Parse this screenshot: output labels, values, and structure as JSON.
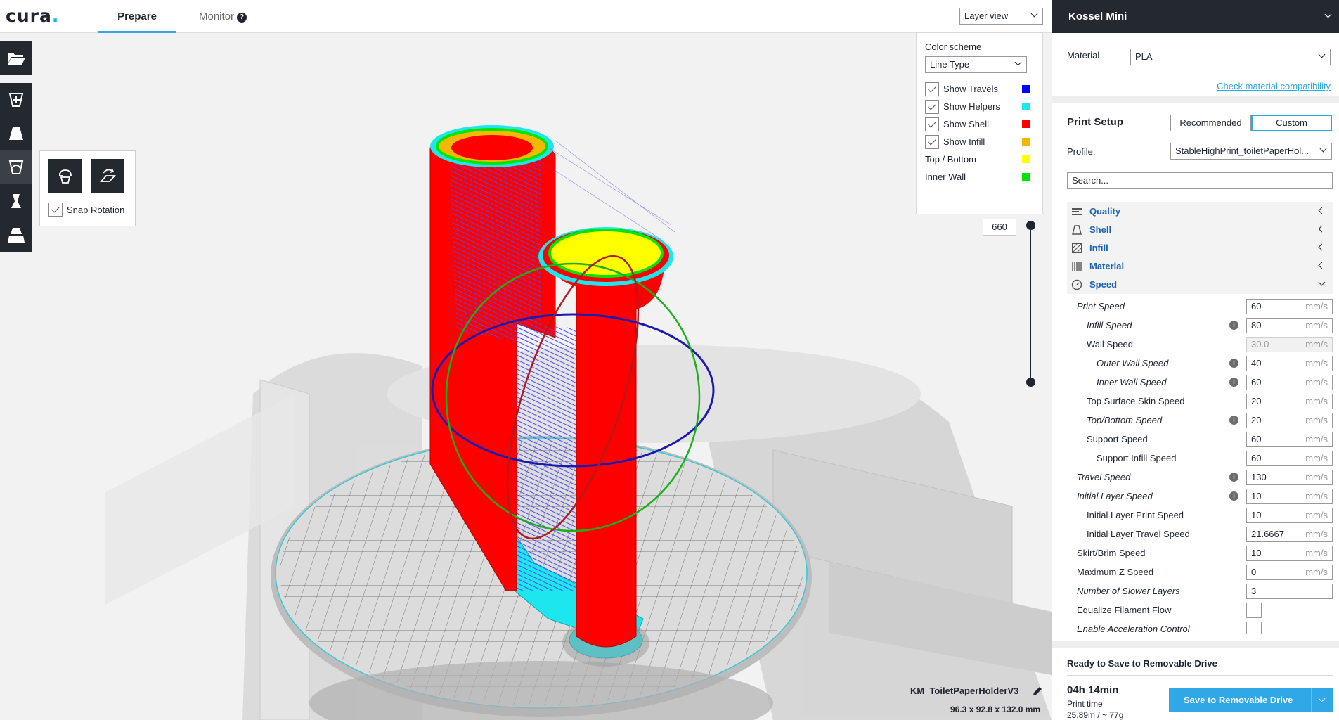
{
  "app": {
    "logo": "cura",
    "logo_dot": "."
  },
  "tabs": [
    {
      "label": "Prepare",
      "active": true
    },
    {
      "label": "Monitor",
      "active": false
    }
  ],
  "help_icon": "?",
  "view_select": {
    "value": "Layer view"
  },
  "left_tools": [
    "open-file-icon",
    "move-icon",
    "scale-icon",
    "rotate-icon",
    "mirror-icon",
    "per-model-settings-icon"
  ],
  "rotate_panel": {
    "snap_label": "Snap Rotation",
    "snap_checked": true
  },
  "legend": {
    "title": "Color scheme",
    "scheme": "Line Type",
    "rows": [
      {
        "label": "Show Travels",
        "checked": true,
        "color": "#0000ff"
      },
      {
        "label": "Show Helpers",
        "checked": true,
        "color": "#1ee6ee"
      },
      {
        "label": "Show Shell",
        "checked": true,
        "color": "#ff0000"
      },
      {
        "label": "Show Infill",
        "checked": true,
        "color": "#f5b800"
      },
      {
        "label": "Top / Bottom",
        "checked": null,
        "color": "#ffff00"
      },
      {
        "label": "Inner Wall",
        "checked": null,
        "color": "#00e600"
      }
    ]
  },
  "layer": {
    "number": "660"
  },
  "model": {
    "name": "KM_ToiletPaperHolderV3",
    "dimensions": "96.3 x 92.8 x 132.0 mm"
  },
  "printer": {
    "name": "Kossel Mini"
  },
  "material": {
    "label": "Material",
    "value": "PLA",
    "link": "Check material compatibility"
  },
  "print_setup": {
    "title": "Print Setup",
    "mode_recommended": "Recommended",
    "mode_custom": "Custom",
    "profile_label": "Profile:",
    "profile_value": "StableHighPrint_toiletPaperHol...",
    "search_placeholder": "Search..."
  },
  "sections": [
    {
      "label": "Quality",
      "icon": "quality-icon",
      "open": false
    },
    {
      "label": "Shell",
      "icon": "shell-icon",
      "open": false
    },
    {
      "label": "Infill",
      "icon": "infill-icon",
      "open": false
    },
    {
      "label": "Material",
      "icon": "material-icon",
      "open": false
    },
    {
      "label": "Speed",
      "icon": "speed-icon",
      "open": true
    }
  ],
  "speed_settings": [
    {
      "label": "Print Speed",
      "value": "60",
      "unit": "mm/s",
      "indent": 0,
      "italic": true,
      "info": false,
      "disabled": false
    },
    {
      "label": "Infill Speed",
      "value": "80",
      "unit": "mm/s",
      "indent": 1,
      "italic": true,
      "info": true,
      "disabled": false
    },
    {
      "label": "Wall Speed",
      "value": "30.0",
      "unit": "mm/s",
      "indent": 1,
      "italic": false,
      "info": false,
      "disabled": true
    },
    {
      "label": "Outer Wall Speed",
      "value": "40",
      "unit": "mm/s",
      "indent": 2,
      "italic": true,
      "info": true,
      "disabled": false
    },
    {
      "label": "Inner Wall Speed",
      "value": "60",
      "unit": "mm/s",
      "indent": 2,
      "italic": true,
      "info": true,
      "disabled": false
    },
    {
      "label": "Top Surface Skin Speed",
      "value": "20",
      "unit": "mm/s",
      "indent": 1,
      "italic": false,
      "info": false,
      "disabled": false
    },
    {
      "label": "Top/Bottom Speed",
      "value": "20",
      "unit": "mm/s",
      "indent": 1,
      "italic": true,
      "info": true,
      "disabled": false
    },
    {
      "label": "Support Speed",
      "value": "60",
      "unit": "mm/s",
      "indent": 1,
      "italic": false,
      "info": false,
      "disabled": false
    },
    {
      "label": "Support Infill Speed",
      "value": "60",
      "unit": "mm/s",
      "indent": 2,
      "italic": false,
      "info": false,
      "disabled": false
    },
    {
      "label": "Travel Speed",
      "value": "130",
      "unit": "mm/s",
      "indent": 0,
      "italic": true,
      "info": true,
      "disabled": false
    },
    {
      "label": "Initial Layer Speed",
      "value": "10",
      "unit": "mm/s",
      "indent": 0,
      "italic": true,
      "info": true,
      "disabled": false
    },
    {
      "label": "Initial Layer Print Speed",
      "value": "10",
      "unit": "mm/s",
      "indent": 1,
      "italic": false,
      "info": false,
      "disabled": false
    },
    {
      "label": "Initial Layer Travel Speed",
      "value": "21.6667",
      "unit": "mm/s",
      "indent": 1,
      "italic": false,
      "info": false,
      "disabled": false
    },
    {
      "label": "Skirt/Brim Speed",
      "value": "10",
      "unit": "mm/s",
      "indent": 0,
      "italic": false,
      "info": false,
      "disabled": false
    },
    {
      "label": "Maximum Z Speed",
      "value": "0",
      "unit": "mm/s",
      "indent": 0,
      "italic": false,
      "info": false,
      "disabled": false
    },
    {
      "label": "Number of Slower Layers",
      "value": "3",
      "unit": "",
      "indent": 0,
      "italic": true,
      "info": false,
      "disabled": false
    },
    {
      "label": "Equalize Filament Flow",
      "value": null,
      "unit": "",
      "indent": 0,
      "italic": false,
      "info": false,
      "disabled": false,
      "checkbox": true
    },
    {
      "label": "Enable Acceleration Control",
      "value": null,
      "unit": "",
      "indent": 0,
      "italic": true,
      "info": false,
      "disabled": false,
      "checkbox": true
    }
  ],
  "save": {
    "ready_text": "Ready to Save to Removable Drive",
    "print_time": "04h 14min",
    "print_time_label": "Print time",
    "material_usage": "25.89m / ~ 77g",
    "button_label": "Save to Removable Drive"
  },
  "colors": {
    "accent": "#30a8e8",
    "dark": "#24282f",
    "link": "#1e62b4"
  }
}
